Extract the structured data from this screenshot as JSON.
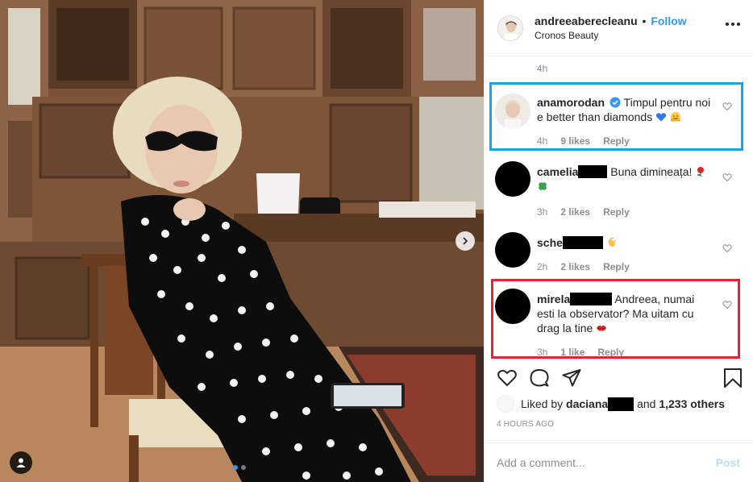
{
  "header": {
    "username": "andreeaberecleanu",
    "separator": "•",
    "follow_label": "Follow",
    "location": "Cronos Beauty"
  },
  "caption": {
    "time": "4h"
  },
  "comments": [
    {
      "username": "anamorodan",
      "verified": true,
      "text": "Timpul pentru noi e better than diamonds",
      "emojis": [
        "blue-heart",
        "hugging-face"
      ],
      "time": "4h",
      "likes": "9 likes",
      "reply_label": "Reply"
    },
    {
      "username": "camelia",
      "redacted": true,
      "text": "Buna dimineața!",
      "emojis": [
        "rose",
        "four-leaf-clover"
      ],
      "time": "3h",
      "likes": "2 likes",
      "reply_label": "Reply"
    },
    {
      "username": "sche",
      "redacted": true,
      "text": "",
      "emojis": [
        "clapping-hands"
      ],
      "time": "2h",
      "likes": "2 likes",
      "reply_label": "Reply"
    },
    {
      "username": "mirela",
      "redacted": true,
      "text": "Andreea, numai esti la observator? Ma uitam cu drag la tine",
      "emojis": [
        "kiss-lips"
      ],
      "time": "3h",
      "likes": "1 like",
      "reply_label": "Reply"
    }
  ],
  "likes": {
    "prefix": "Liked by",
    "user": "daciana",
    "middle": "and",
    "others": "1,233 others"
  },
  "timestamp": "4 HOURS AGO",
  "add_comment": {
    "placeholder": "Add a comment...",
    "post_label": "Post"
  },
  "colors": {
    "link_blue": "#3897f0",
    "highlight_blue": "#1ca2e6",
    "highlight_red": "#e32630",
    "muted": "#8e8e8e"
  },
  "icons": [
    "heart-icon",
    "comment-icon",
    "share-icon",
    "bookmark-icon",
    "more-icon",
    "user-tag-icon",
    "next-arrow-icon"
  ]
}
